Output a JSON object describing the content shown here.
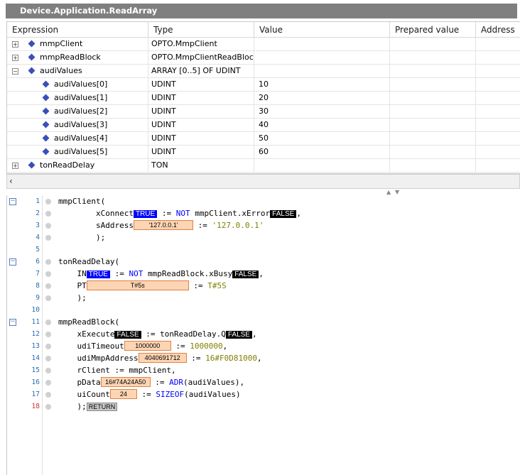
{
  "window": {
    "title": "Device.Application.ReadArray"
  },
  "watch": {
    "columns": [
      "Expression",
      "Type",
      "Value",
      "Prepared value",
      "Address"
    ],
    "rows": [
      {
        "expander": "+",
        "expression": "mmpClient",
        "type": "OPTO.MmpClient",
        "value": ""
      },
      {
        "expander": "+",
        "expression": "mmpReadBlock",
        "type": "OPTO.MmpClientReadBlock",
        "value": ""
      },
      {
        "expander": "−",
        "expression": "audiValues",
        "type": "ARRAY [0..5] OF UDINT",
        "value": ""
      },
      {
        "expander": "",
        "expression": "audiValues[0]",
        "type": "UDINT",
        "value": "10"
      },
      {
        "expander": "",
        "expression": "audiValues[1]",
        "type": "UDINT",
        "value": "20"
      },
      {
        "expander": "",
        "expression": "audiValues[2]",
        "type": "UDINT",
        "value": "30"
      },
      {
        "expander": "",
        "expression": "audiValues[3]",
        "type": "UDINT",
        "value": "40"
      },
      {
        "expander": "",
        "expression": "audiValues[4]",
        "type": "UDINT",
        "value": "50"
      },
      {
        "expander": "",
        "expression": "audiValues[5]",
        "type": "UDINT",
        "value": "60"
      },
      {
        "expander": "+",
        "expression": "tonReadDelay",
        "type": "TON",
        "value": ""
      }
    ]
  },
  "code": {
    "line_numbers": [
      "1",
      "2",
      "3",
      "4",
      "5",
      "6",
      "7",
      "8",
      "9",
      "10",
      "11",
      "12",
      "13",
      "14",
      "15",
      "16",
      "17",
      "18"
    ],
    "l1": "mmpClient(",
    "l2": {
      "a": "        xConnect",
      "ov": "TRUE",
      "b": " := ",
      "kw": "NOT",
      "c": " mmpClient.xError",
      "ov2": "FALSE",
      "d": ","
    },
    "l3": {
      "a": "        sAddress",
      "ov": "'127.0.0.1'",
      "b": " := ",
      "s": "'127.0.0.1'"
    },
    "l4": "        );",
    "l6": "tonReadDelay(",
    "l7": {
      "a": "    IN",
      "ov": "TRUE",
      "b": " := ",
      "kw": "NOT",
      "c": " mmpReadBlock.xBusy",
      "ov2": "FALSE",
      "d": ","
    },
    "l8": {
      "a": "    PT",
      "ov": "T#5s",
      "b": " := ",
      "s": "T#5S"
    },
    "l9": "    );",
    "l11": "mmpReadBlock(",
    "l12": {
      "a": "    xExecute",
      "ov": "FALSE",
      "b": " := tonReadDelay.Q",
      "ov2": "FALSE",
      "d": ","
    },
    "l13": {
      "a": "    udiTimeout",
      "ov": "1000000",
      "b": " := ",
      "n": "1000000",
      "d": ","
    },
    "l14": {
      "a": "    udiMmpAddress",
      "ov": "4040691712",
      "b": " := ",
      "n": "16#F0D81000",
      "d": ","
    },
    "l15": "    rClient := mmpClient,",
    "l16": {
      "a": "    pData",
      "ov": "16#74A24A50",
      "b": " := ",
      "kw": "ADR",
      "c": "(audiValues),"
    },
    "l17": {
      "a": "    uiCount",
      "ov": "24",
      "b": " := ",
      "kw": "SIZEOF",
      "c": "(audiValues)"
    },
    "l18": {
      "a": "    );",
      "ov": "RETURN"
    }
  }
}
